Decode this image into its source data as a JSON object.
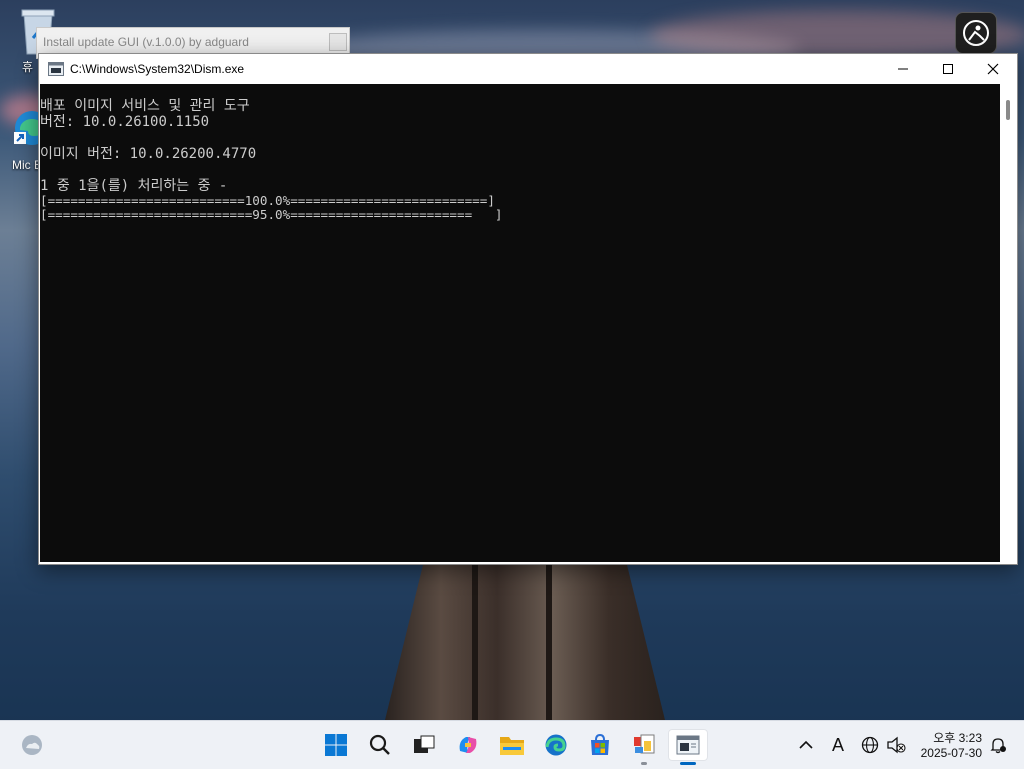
{
  "desktop": {
    "icons": [
      {
        "label": "휴",
        "icon": "recycle-bin-icon"
      },
      {
        "label": "Mic E",
        "icon": "edge-shortcut-icon"
      }
    ],
    "corner_button_icon": "accessibility-icon"
  },
  "background_window": {
    "title": "Install update GUI (v.1.0.0) by adguard"
  },
  "console": {
    "title": "C:\\Windows\\System32\\Dism.exe",
    "icon": "console-app-icon",
    "lines": [
      "배포 이미지 서비스 및 관리 도구",
      "버전: 10.0.26100.1150",
      "",
      "이미지 버전: 10.0.26200.4770",
      "",
      "1 중 1을(를) 처리하는 중 -",
      "[==========================100.0%==========================]",
      "[===========================95.0%========================   ]"
    ],
    "progress": [
      1.0,
      0.95
    ]
  },
  "taskbar": {
    "widgets_icon": "weather-widget-icon",
    "apps": [
      {
        "name": "start",
        "icon": "windows-start-icon"
      },
      {
        "name": "search",
        "icon": "search-icon"
      },
      {
        "name": "task-view",
        "icon": "task-view-icon"
      },
      {
        "name": "copilot",
        "icon": "copilot-icon"
      },
      {
        "name": "file-explorer",
        "icon": "folder-icon"
      },
      {
        "name": "edge",
        "icon": "edge-icon"
      },
      {
        "name": "store",
        "icon": "store-icon"
      },
      {
        "name": "install-gui",
        "icon": "installer-app-icon"
      },
      {
        "name": "console",
        "icon": "console-app-icon"
      }
    ],
    "tray": {
      "chevron_icon": "chevron-up-icon",
      "ime_label": "A",
      "network_icon": "network-globe-icon",
      "volume_icon": "volume-muted-icon",
      "time": "오후 3:23",
      "date": "2025-07-30",
      "notification_icon": "notification-bell-icon"
    }
  },
  "colors": {
    "console_bg": "#0c0c0c",
    "console_fg": "#cccccc",
    "taskbar_bg": "#eef1f6",
    "accent": "#0067c0"
  }
}
